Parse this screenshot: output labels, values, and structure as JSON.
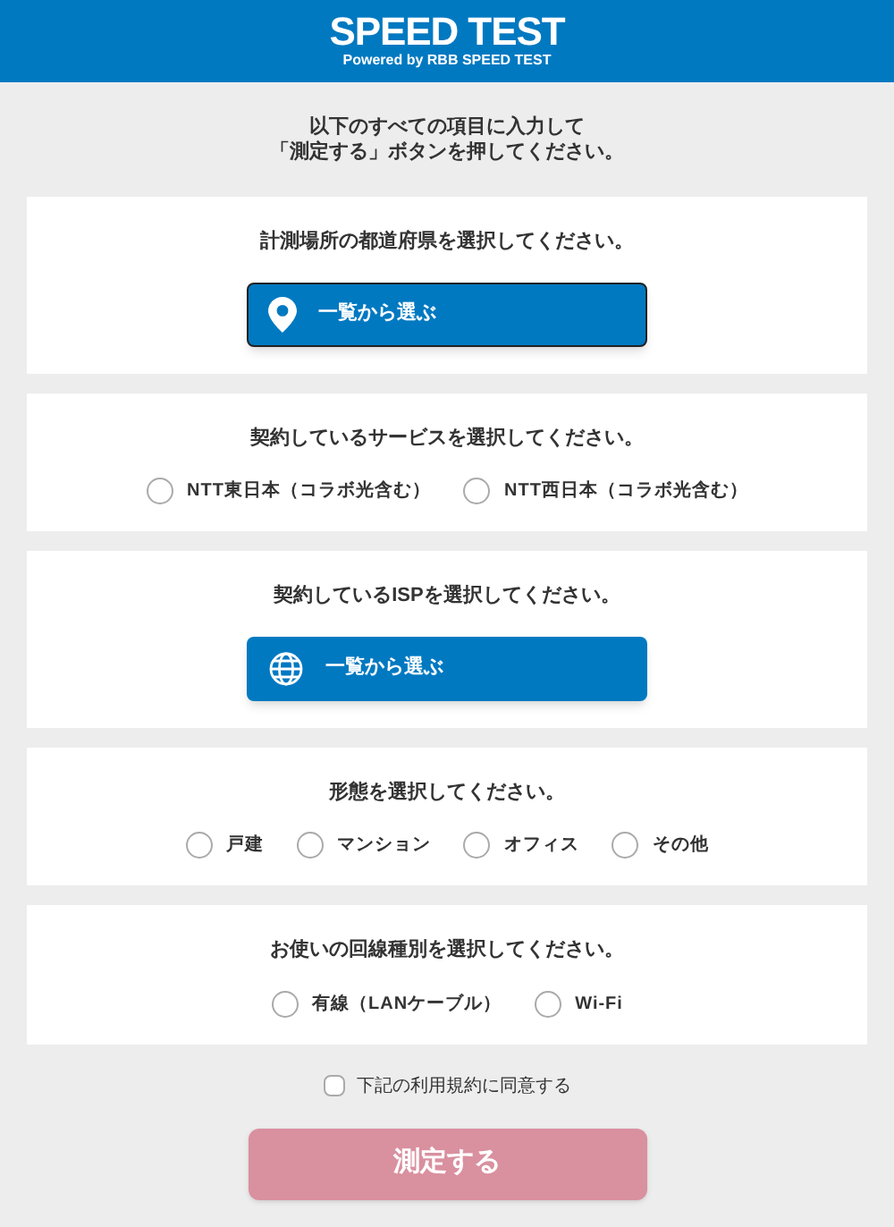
{
  "header": {
    "title": "SPEED TEST",
    "subtitle": "Powered by RBB SPEED TEST"
  },
  "intro": [
    "以下のすべての項目に入力して",
    "「測定する」ボタンを押してください。"
  ],
  "sections": [
    {
      "kind": "button",
      "title": "計測場所の都道府県を選択してください。",
      "button": {
        "label": "一覧から選ぶ",
        "focused": true
      }
    },
    {
      "kind": "radio",
      "title": "契約しているサービスを選択してください。",
      "options": [
        {
          "label": "NTT東日本（コラボ光含む）",
          "selected": false
        },
        {
          "label": "NTT西日本（コラボ光含む）",
          "selected": false
        }
      ]
    },
    {
      "kind": "button",
      "title": "契約しているISPを選択してください。",
      "button": {
        "label": "一覧から選ぶ",
        "focused": false
      }
    },
    {
      "kind": "radio",
      "title": "形態を選択してください。",
      "options": [
        {
          "label": "戸建",
          "selected": false
        },
        {
          "label": "マンション",
          "selected": false
        },
        {
          "label": "オフィス",
          "selected": false
        },
        {
          "label": "その他",
          "selected": false
        }
      ]
    },
    {
      "kind": "radio",
      "title": "お使いの回線種別を選択してください。",
      "options": [
        {
          "label": "有線（LANケーブル）",
          "selected": false
        },
        {
          "label": "Wi-Fi",
          "selected": false
        }
      ]
    }
  ],
  "agreement": {
    "label": "下記の利用規約に同意する",
    "checked": false
  },
  "submit": {
    "label": "測定する",
    "disabled": true
  }
}
